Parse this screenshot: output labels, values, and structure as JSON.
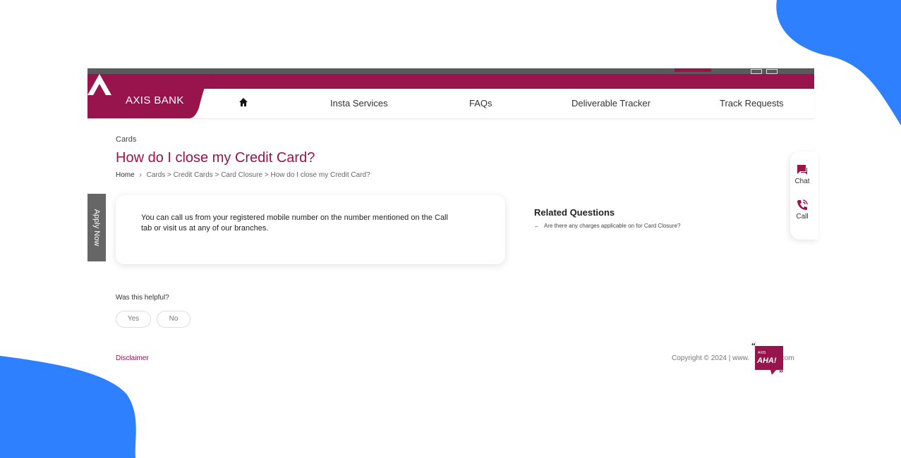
{
  "colors": {
    "brand": "#97144d",
    "accent_blob": "#2f80ff"
  },
  "header": {
    "logo_text": "AXIS BANK",
    "nav": [
      "Insta Services",
      "FAQs",
      "Deliverable Tracker",
      "Track Requests"
    ],
    "home_icon": "home-icon"
  },
  "page": {
    "section": "Cards",
    "title": "How do I close my Credit Card?",
    "breadcrumb": {
      "home": "Home",
      "separator": "›",
      "trail": "Cards > Credit Cards > Card Closure > How do I close my Credit Card?"
    }
  },
  "answer": {
    "text": "You can call us from your registered mobile number on the number mentioned on the Call tab or visit us at any of our branches."
  },
  "related": {
    "title": "Related Questions",
    "items": [
      "Are there any charges applicable on for Card Closure?"
    ]
  },
  "side": {
    "apply_now": "Apply Now",
    "chat": "Chat",
    "call": "Call"
  },
  "feedback": {
    "question": "Was this helpful?",
    "yes": "Yes",
    "no": "No"
  },
  "footer": {
    "disclaimer": "Disclaimer",
    "copyright_prefix": "Copyright © 2024 | www.",
    "copyright_suffix": ".com",
    "aha_small": "AXIS",
    "aha_big": "AHA!"
  }
}
